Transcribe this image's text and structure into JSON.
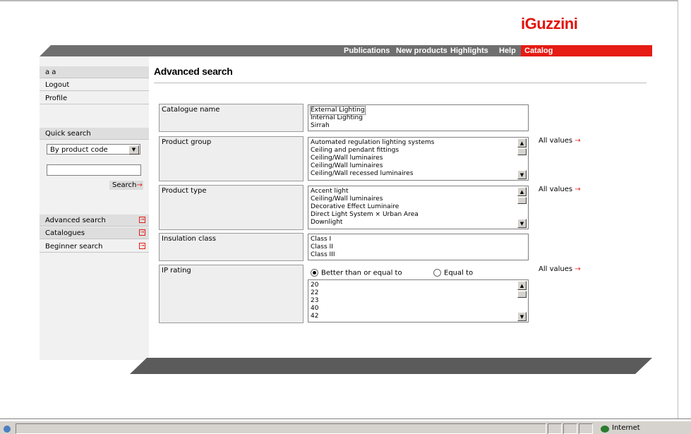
{
  "brand": {
    "logo": "iGuzzini",
    "accent": "#e51b14",
    "bar_color": "#6f6f6f"
  },
  "nav": [
    "Publications",
    "New products",
    "Highlights",
    "Help",
    "Catalog"
  ],
  "sidebar": {
    "top": "a a",
    "logout": "Logout",
    "profile": "Profile",
    "quick_search": "Quick search",
    "select_value": "By product code",
    "search_button": "Search",
    "links": [
      "Advanced search",
      "Catalogues",
      "Beginner search"
    ]
  },
  "main": {
    "title": "Advanced search",
    "all_values": "All values",
    "fields": [
      {
        "label": "Catalogue name",
        "options": [
          "External Lighting",
          "Internal Lighting",
          "Sirrah"
        ]
      },
      {
        "label": "Product group",
        "options": [
          "Automated regulation lighting systems",
          "Ceiling and pendant fittings",
          "Ceiling/Wall luminaires",
          "Ceiling/Wall luminaires",
          "Ceiling/Wall recessed luminaires"
        ]
      },
      {
        "label": "Product type",
        "options": [
          "Accent light",
          "Ceiling/Wall luminaires",
          "Decorative Effect Luminaire",
          "Direct Light System × Urban Area",
          "Downlight"
        ]
      },
      {
        "label": "Insulation class",
        "options": [
          "Class I",
          "Class II",
          "Class III"
        ]
      },
      {
        "label": "IP rating",
        "radio_better": "Better than or equal to",
        "radio_equal": "Equal to",
        "options": [
          "20",
          "22",
          "23",
          "40",
          "42"
        ]
      }
    ]
  },
  "status": {
    "zone": "Internet"
  }
}
